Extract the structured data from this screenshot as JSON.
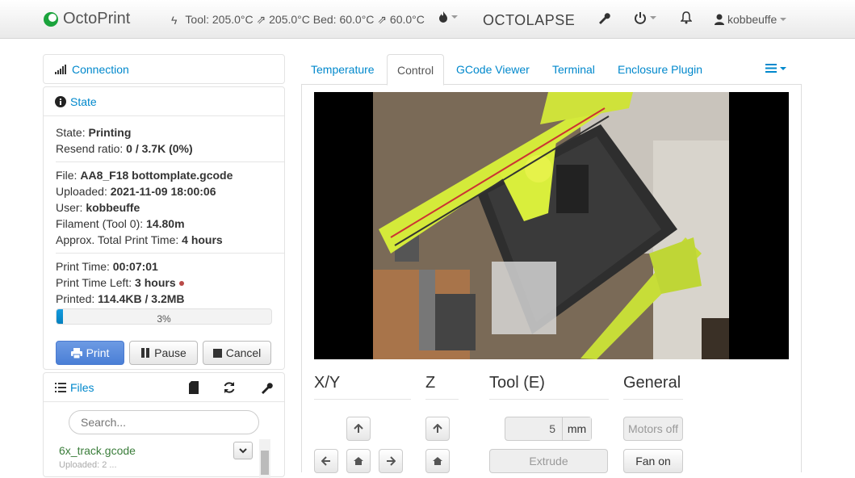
{
  "navbar": {
    "brand": "OctoPrint",
    "status": "Tool: 205.0°C ⇗ 205.0°C Bed: 60.0°C ⇗ 60.0°C",
    "octolapse": "OCTOLAPSE",
    "user": "kobbeuffe"
  },
  "sidebar": {
    "connection": "Connection",
    "state": {
      "title": "State",
      "state_label": "State:",
      "state_value": "Printing",
      "resend_label": "Resend ratio:",
      "resend_value": "0 / 3.7K (0%)",
      "file_label": "File:",
      "file_value": "AA8_F18 bottomplate.gcode",
      "uploaded_label": "Uploaded:",
      "uploaded_value": "2021-11-09 18:00:06",
      "user_label": "User:",
      "user_value": "kobbeuffe",
      "filament_label": "Filament (Tool 0):",
      "filament_value": "14.80m",
      "approx_label": "Approx. Total Print Time:",
      "approx_value": "4 hours",
      "printtime_label": "Print Time:",
      "printtime_value": "00:07:01",
      "left_label": "Print Time Left:",
      "left_value": "3 hours",
      "printed_label": "Printed:",
      "printed_value": "114.4KB / 3.2MB",
      "progress_label": "3%",
      "progress_fraction": 0.03,
      "print_btn": "Print",
      "pause_btn": "Pause",
      "cancel_btn": "Cancel"
    },
    "files": {
      "title": "Files",
      "search_placeholder": "Search...",
      "item_name": "6x_track.gcode",
      "item_sub": "Uploaded: 2 ..."
    }
  },
  "tabs": [
    "Temperature",
    "Control",
    "GCode Viewer",
    "Terminal",
    "Enclosure Plugin"
  ],
  "control": {
    "xy": "X/Y",
    "z": "Z",
    "tool": "Tool (E)",
    "general": "General",
    "mm_value": "5",
    "mm_unit": "mm",
    "extrude": "Extrude",
    "motors_off": "Motors off",
    "fan_on": "Fan on"
  }
}
